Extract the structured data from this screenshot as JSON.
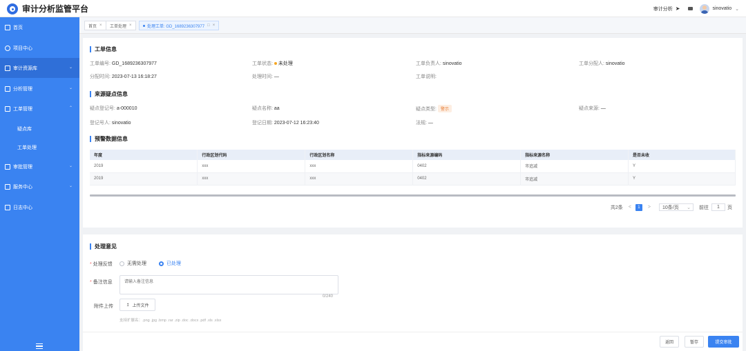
{
  "app": {
    "title": "审计分析监管平台"
  },
  "header": {
    "audit_analysis": "审计分析",
    "username": "sinovatio"
  },
  "sidebar": {
    "items": [
      {
        "label": "首页"
      },
      {
        "label": "项目中心"
      },
      {
        "label": "审计资源库"
      },
      {
        "label": "分析管理"
      },
      {
        "label": "工单管理"
      },
      {
        "label": "疑点库"
      },
      {
        "label": "工单处理"
      },
      {
        "label": "审批管理"
      },
      {
        "label": "服务中心"
      },
      {
        "label": "日志中心"
      }
    ]
  },
  "tabs": [
    {
      "label": "首页"
    },
    {
      "label": "工单处理"
    },
    {
      "label": "处理工单: GD_1689236307977"
    }
  ],
  "work_order": {
    "title": "工单信息",
    "no_label": "工单编号:",
    "no": "GD_1689236307977",
    "status_label": "工单状态:",
    "status": "未处理",
    "owner_label": "工单负责人:",
    "owner": "sinovatio",
    "assigner_label": "工单分配人:",
    "assigner": "sinovatio",
    "assign_time_label": "分配时间:",
    "assign_time": "2023-07-13 16:18:27",
    "process_time_label": "处理时间:",
    "process_time": "—",
    "desc_label": "工单说明:",
    "desc": ""
  },
  "source": {
    "title": "来源疑点信息",
    "reg_no_label": "疑点登记号:",
    "reg_no": "a-000010",
    "name_label": "疑点名称:",
    "name": "aa",
    "type_label": "疑点类型:",
    "type": "警示",
    "origin_label": "疑点来源:",
    "origin": "—",
    "registrant_label": "登记号人:",
    "registrant": "sinovatio",
    "reg_date_label": "登记日期:",
    "reg_date": "2023-07-12 16:23:40",
    "law_label": "法规:",
    "law": "—"
  },
  "warning": {
    "title": "预警数据信息",
    "columns": [
      "年度",
      "行政区划代码",
      "行政区划名称",
      "指标来源编码",
      "指标来源名称",
      "是否未收"
    ],
    "rows": [
      [
        "2019",
        "xxx",
        "xxx",
        "0402",
        "市追减",
        "Y"
      ],
      [
        "2019",
        "xxx",
        "xxx",
        "0402",
        "市追减",
        "Y"
      ]
    ]
  },
  "pagination": {
    "total": "共2条",
    "prev": "<",
    "page": "1",
    "next": ">",
    "page_size": "10条/页",
    "goto_label": "前往",
    "goto_value": "1",
    "goto_unit": "页"
  },
  "opinion": {
    "title": "处理意见",
    "feedback_label": "处理反馈",
    "option_no": "无需处理",
    "option_done": "已处理",
    "remark_label": "备注信息",
    "remark_placeholder": "请输入备注信息",
    "counter": "0/240",
    "attach_label": "附件上传",
    "upload_label": "上传文件",
    "hint": "支持扩展名：.png .jpg .bmp .rar .zip .doc .docx .pdf .xls .xlsx"
  },
  "actions": {
    "back": "返回",
    "save": "暂存",
    "submit": "提交审批"
  },
  "colors": {
    "primary": "#3a83f1",
    "sidebar": "#3a83f1",
    "warning_tag": "#e8803a"
  }
}
